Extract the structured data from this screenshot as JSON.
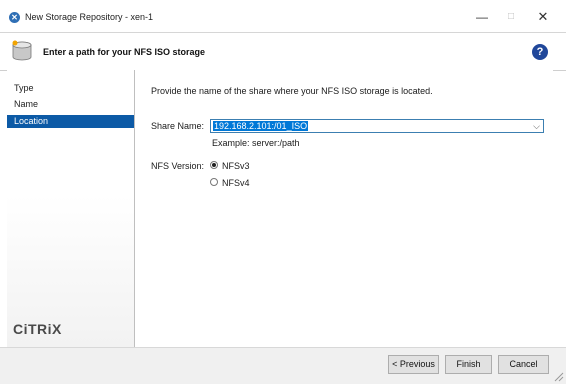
{
  "window": {
    "title": "New Storage Repository - xen-1",
    "minimize": "—",
    "maximize": "□",
    "close": "✕"
  },
  "header": {
    "title": "Enter a path for your NFS ISO storage",
    "help": "?"
  },
  "nav": {
    "items": [
      {
        "label": "Type"
      },
      {
        "label": "Name"
      },
      {
        "label": "Location",
        "selected": true
      }
    ],
    "logo": "CiTRiX"
  },
  "content": {
    "description": "Provide the name of the share where your NFS ISO storage is located.",
    "share_label": "Share Name:",
    "share_value": "192.168.2.101:/01_ISO",
    "example": "Example: server:/path",
    "nfs_label": "NFS Version:",
    "options": [
      {
        "label": "NFSv3",
        "selected": true
      },
      {
        "label": "NFSv4",
        "selected": false
      }
    ]
  },
  "footer": {
    "previous": "< Previous",
    "finish": "Finish",
    "cancel": "Cancel"
  },
  "colors": {
    "accent": "#0c5aa6",
    "selection": "#0078d7",
    "help_icon": "#20479a"
  }
}
